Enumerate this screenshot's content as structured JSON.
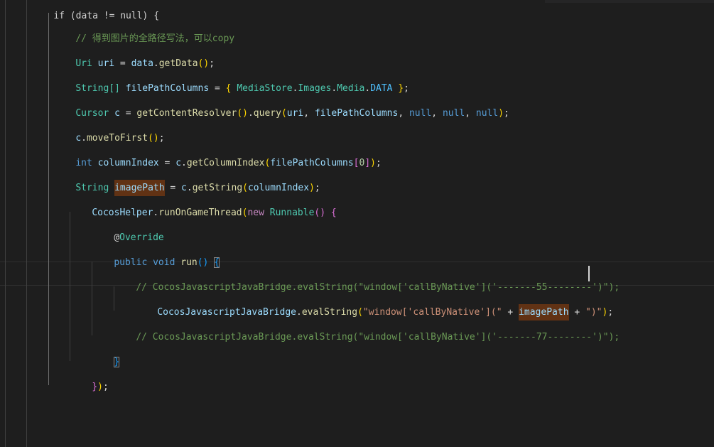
{
  "code": {
    "top_line": "if (data != null) {",
    "comment_path": "// 得到图片的全路径写法，可以copy",
    "l_uri": {
      "type": "Uri",
      "var": "uri",
      "eq": " = ",
      "obj": "data",
      "dot": ".",
      "fn": "getData",
      "call": "()",
      "semi": ";"
    },
    "l_columns": {
      "type": "String[]",
      "var": "filePathColumns",
      "eq": " = ",
      "open": "{",
      "sp": " ",
      "a": "MediaStore",
      "b": "Images",
      "c": "Media",
      "d": "DATA",
      "close": "}",
      "semi": ";"
    },
    "l_cursor": {
      "type": "Cursor",
      "var": "c",
      "eq": " = ",
      "fn1": "getContentResolver",
      "call": "()",
      "fn2": "query",
      "open": "(",
      "arg1": "uri",
      "comma": ", ",
      "arg2": "filePathColumns",
      "null": "null",
      "close": ")",
      "semi": ";"
    },
    "l_move": {
      "obj": "c",
      "fn": "moveToFirst",
      "call": "()",
      "semi": ";"
    },
    "l_index": {
      "kw": "int",
      "var": "columnIndex",
      "eq": " = ",
      "obj": "c",
      "fn": "getColumnIndex",
      "open": "(",
      "arg": "filePathColumns",
      "bo": "[",
      "num": "0",
      "bc": "]",
      "close": ")",
      "semi": ";"
    },
    "l_path": {
      "type": "String",
      "var": "imagePath",
      "eq": " = ",
      "obj": "c",
      "fn": "getString",
      "open": "(",
      "arg": "columnIndex",
      "close": ")",
      "semi": ";"
    },
    "l_helper": {
      "obj": "CocosHelper",
      "fn": "runOnGameThread",
      "open": "(",
      "kw": "new",
      "type": "Runnable",
      "call": "()",
      "brace": "{"
    },
    "l_override": {
      "at": "@",
      "name": "Override"
    },
    "l_run": {
      "kw1": "public",
      "kw2": "void",
      "fn": "run",
      "call": "()",
      "brace": "{"
    },
    "comment_55": "// CocosJavascriptJavaBridge.evalString(\"window['callByNative']('-------55--------')\");",
    "l_eval": {
      "obj": "CocosJavascriptJavaBridge",
      "fn": "evalString",
      "open": "(",
      "str1": "\"window['callByNative'](\"",
      "plus": " + ",
      "var": "imagePath",
      "str2": "\")\"",
      "close": ")",
      "semi": ";"
    },
    "comment_77": "// CocosJavascriptJavaBridge.evalString(\"window['callByNative']('-------77--------')\");",
    "l_close_run": "}",
    "l_close_helper": {
      "brace": "}",
      "paren": ")",
      "semi": ";"
    }
  }
}
